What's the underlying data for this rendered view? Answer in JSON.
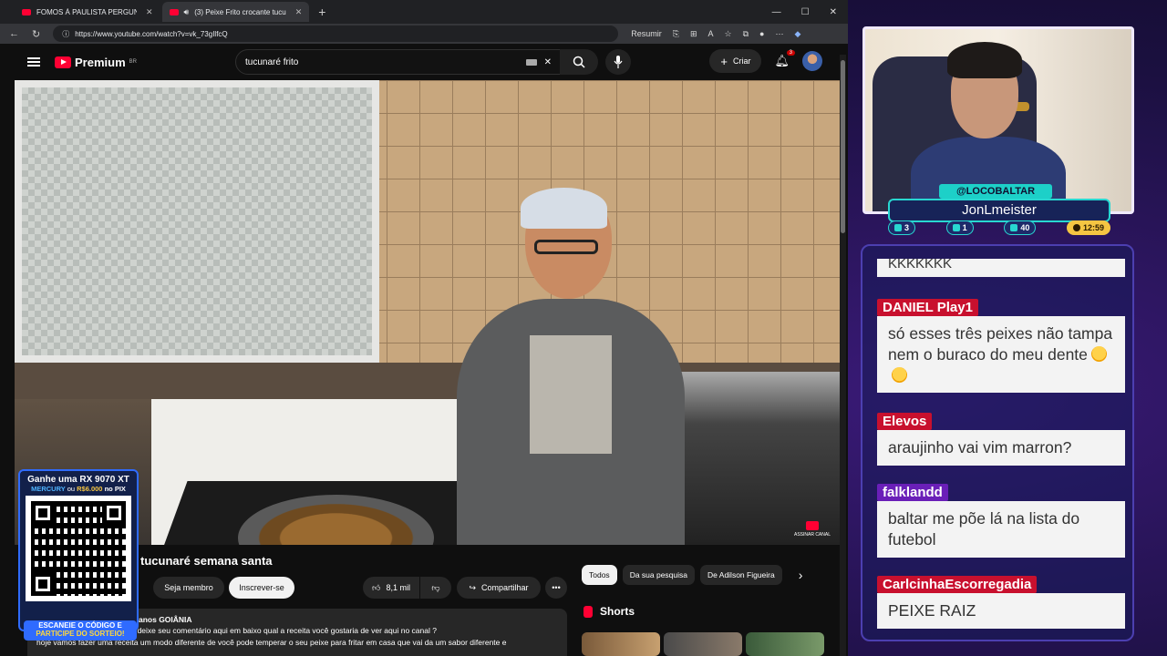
{
  "browser": {
    "tabs": [
      {
        "title": "FOMOS À PAULISTA PERGUNTAR",
        "active": false
      },
      {
        "title": "(3) Peixe Frito crocante tucu",
        "active": true
      }
    ],
    "url": "https://www.youtube.com/watch?v=vk_73gIlfcQ",
    "address_actions": {
      "summarize": "Resumir"
    },
    "window_controls": {
      "minimize": "—",
      "maximize": "☐",
      "close": "✕"
    }
  },
  "youtube": {
    "logo": "Premium",
    "logo_region": "BR",
    "search_value": "tucunaré frito",
    "create_label": "Criar",
    "notifications_count": "3",
    "video": {
      "title": "tucunaré semana santa",
      "watermark": "ASSINAR CANAL",
      "member_label": "Seja membro",
      "subscribe_label": "Inscrever-se",
      "likes": "8,1 mil",
      "share_label": "Compartilhar",
      "more_label": "•••"
    },
    "description": {
      "meta": "anos  GOIÂNIA",
      "line1": "Cade os amantes de peixe ? deixe seu comentário aqui em baixo qual a receita você gostaria  de ver aqui no canal ?",
      "line2": "hoje vamos fazer uma receita um modo diferente de você pode temperar o seu peixe para fritar em casa que vai da um sabor diferente e"
    },
    "chips": [
      "Todos",
      "Da sua pesquisa",
      "De Adilson Figueira"
    ],
    "shorts_label": "Shorts"
  },
  "promo": {
    "headline": "Ganhe uma RX 9070 XT",
    "sub_prefix": "MERCURY",
    "sub_mid": "ou",
    "sub_value": "R$6.000",
    "sub_suffix": "no PIX",
    "footer_line1": "ESCANEIE O CÓDIGO E",
    "footer_line2": "PARTICIPE DO SORTEIO!"
  },
  "streamer": {
    "handle": "@LOCOBALTAR",
    "name": "JonLmeister",
    "stats": [
      {
        "icon": "chat-icon",
        "value": "3"
      },
      {
        "icon": "video-icon",
        "value": "1"
      },
      {
        "icon": "viewers-icon",
        "value": "40"
      },
      {
        "icon": "clock-icon",
        "value": "12:59"
      }
    ]
  },
  "chat": [
    {
      "user": "",
      "text": "KKKKKKK",
      "color": "#ffffff"
    },
    {
      "user": "DANIEL Play1",
      "text": "só esses três peixes não tampa nem o buraco do meu dente",
      "color": "#c8102e",
      "emojis": 2
    },
    {
      "user": "Elevos",
      "text": "araujinho vai vim marron?",
      "color": "#c8102e"
    },
    {
      "user": "falklandd",
      "text": "baltar me põe lá na lista do futebol",
      "color": "#6a1fb8"
    },
    {
      "user": "CarlcinhaEscorregadia",
      "text": "PEIXE RAIZ",
      "color": "#c8102e"
    }
  ]
}
